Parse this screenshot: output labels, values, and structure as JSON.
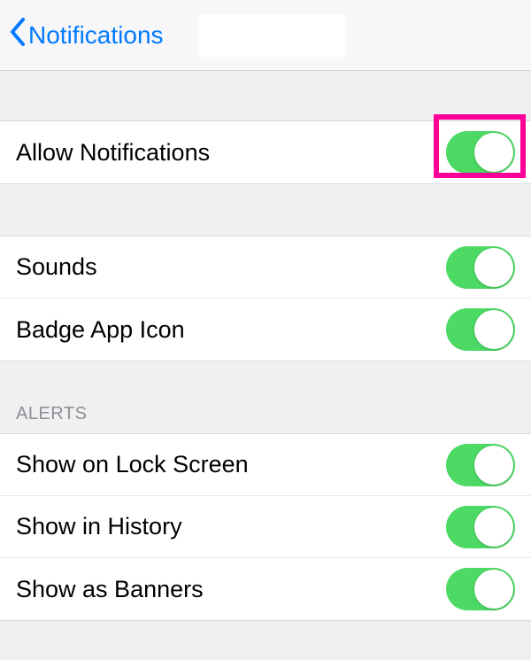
{
  "nav": {
    "back_label": "Notifications"
  },
  "rows": {
    "allow": {
      "label": "Allow Notifications",
      "on": true
    },
    "sounds": {
      "label": "Sounds",
      "on": true
    },
    "badge": {
      "label": "Badge App Icon",
      "on": true
    },
    "lockscreen": {
      "label": "Show on Lock Screen",
      "on": true
    },
    "history": {
      "label": "Show in History",
      "on": true
    },
    "banners": {
      "label": "Show as Banners",
      "on": true
    }
  },
  "sections": {
    "alerts": "ALERTS"
  },
  "colors": {
    "accent": "#007aff",
    "toggle_on": "#4cd964",
    "highlight": "#ff0099"
  }
}
